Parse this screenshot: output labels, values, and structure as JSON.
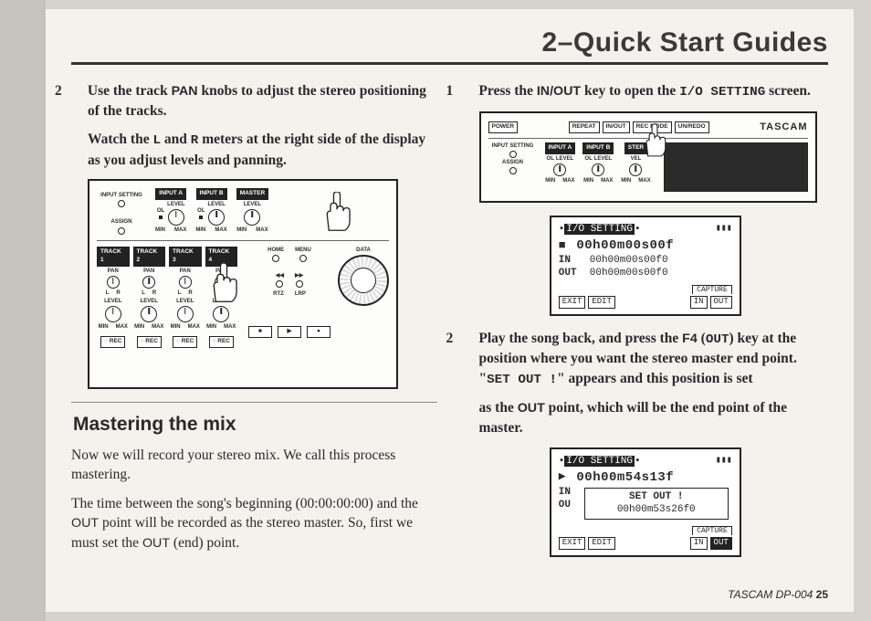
{
  "header": {
    "title": "2–Quick Start Guides"
  },
  "left": {
    "step2_num": "2",
    "step2_text_a": "Use the track ",
    "step2_pan": "PAN",
    "step2_text_b": " knobs to adjust the stereo positioning of the tracks.",
    "watch_a": "Watch the ",
    "watch_L": "L",
    "watch_b": " and ",
    "watch_R": "R",
    "watch_c": " meters at the right side of the display as you adjust levels and panning.",
    "fig1": {
      "input_setting": "INPUT SETTING",
      "assign": "ASSIGN",
      "input_a": "INPUT A",
      "input_b": "INPUT B",
      "master": "MASTER",
      "level": "LEVEL",
      "ol": "OL",
      "min": "MIN",
      "max": "MAX",
      "tracks": [
        "TRACK 1",
        "TRACK 2",
        "TRACK 3",
        "TRACK 4"
      ],
      "pan": "PAN",
      "l": "L",
      "r": "R",
      "home": "HOME",
      "menu": "MENU",
      "data": "DATA",
      "rtz": "RTZ",
      "lrp": "LRP",
      "rec": "REC",
      "stop": "■",
      "play": "▶",
      "record": "●"
    },
    "section_title": "Mastering the mix",
    "para1": "Now we will record your stereo mix. We call this process mastering.",
    "para2_a": "The time between the song's beginning (00:00:00:00) and the ",
    "para2_out": "OUT",
    "para2_b": " point will be recorded as the stereo master. So, first we must set the ",
    "para2_out2": "OUT",
    "para2_c": " (end) point."
  },
  "right": {
    "step1_num": "1",
    "step1_a": "Press the ",
    "step1_inout": "IN/OUT",
    "step1_b": " key to open the ",
    "step1_io": "I/O SETTING",
    "step1_c": " screen.",
    "fig2": {
      "power": "POWER",
      "repeat": "REPEAT",
      "inout": "IN/OUT",
      "recmode": "REC MODE",
      "unredo": "UN/REDO",
      "tascam": "TASCAM",
      "input_setting": "INPUT SETTING",
      "assign": "ASSIGN",
      "input_a": "INPUT A",
      "input_b": "INPUT B",
      "master": "STER",
      "level": "LEVEL",
      "vel": "VEL",
      "ol": "OL",
      "min": "MIN",
      "max": "MAX"
    },
    "lcd1": {
      "title": "I/O SETTING",
      "time": "00h00m00s00f",
      "in_lbl": "IN",
      "in_val": "00h00m00s00f0",
      "out_lbl": "OUT",
      "out_val": "00h00m00s00f0",
      "capture": "CAPTURE",
      "buttons": [
        "EXIT",
        "EDIT",
        "IN",
        "OUT"
      ]
    },
    "step2_num": "2",
    "step2_a": "Play the song back, and press the ",
    "step2_f4": "F4",
    "step2_par_open": " (",
    "step2_out": "OUT",
    "step2_par_close": ")",
    "step2_b": " key at the position where you want the stereo master end point. \"",
    "step2_setout": "SET OUT !",
    "step2_c": "\" appears and this position is set",
    "step2_d_a": "as the ",
    "step2_d_out": "OUT",
    "step2_d_b": " point, which will be the end point of the master.",
    "lcd2": {
      "title": "I/O SETTING",
      "time": "00h00m54s13f",
      "popup_line1": "SET OUT !",
      "popup_line2": "00h00m53s26f0",
      "in_lbl": "IN",
      "out_lbl": "OU",
      "capture": "CAPTURE",
      "buttons": [
        "EXIT",
        "EDIT",
        "IN",
        "OUT"
      ]
    }
  },
  "footer": {
    "brand": "TASCAM  DP-004 ",
    "page": "25"
  }
}
